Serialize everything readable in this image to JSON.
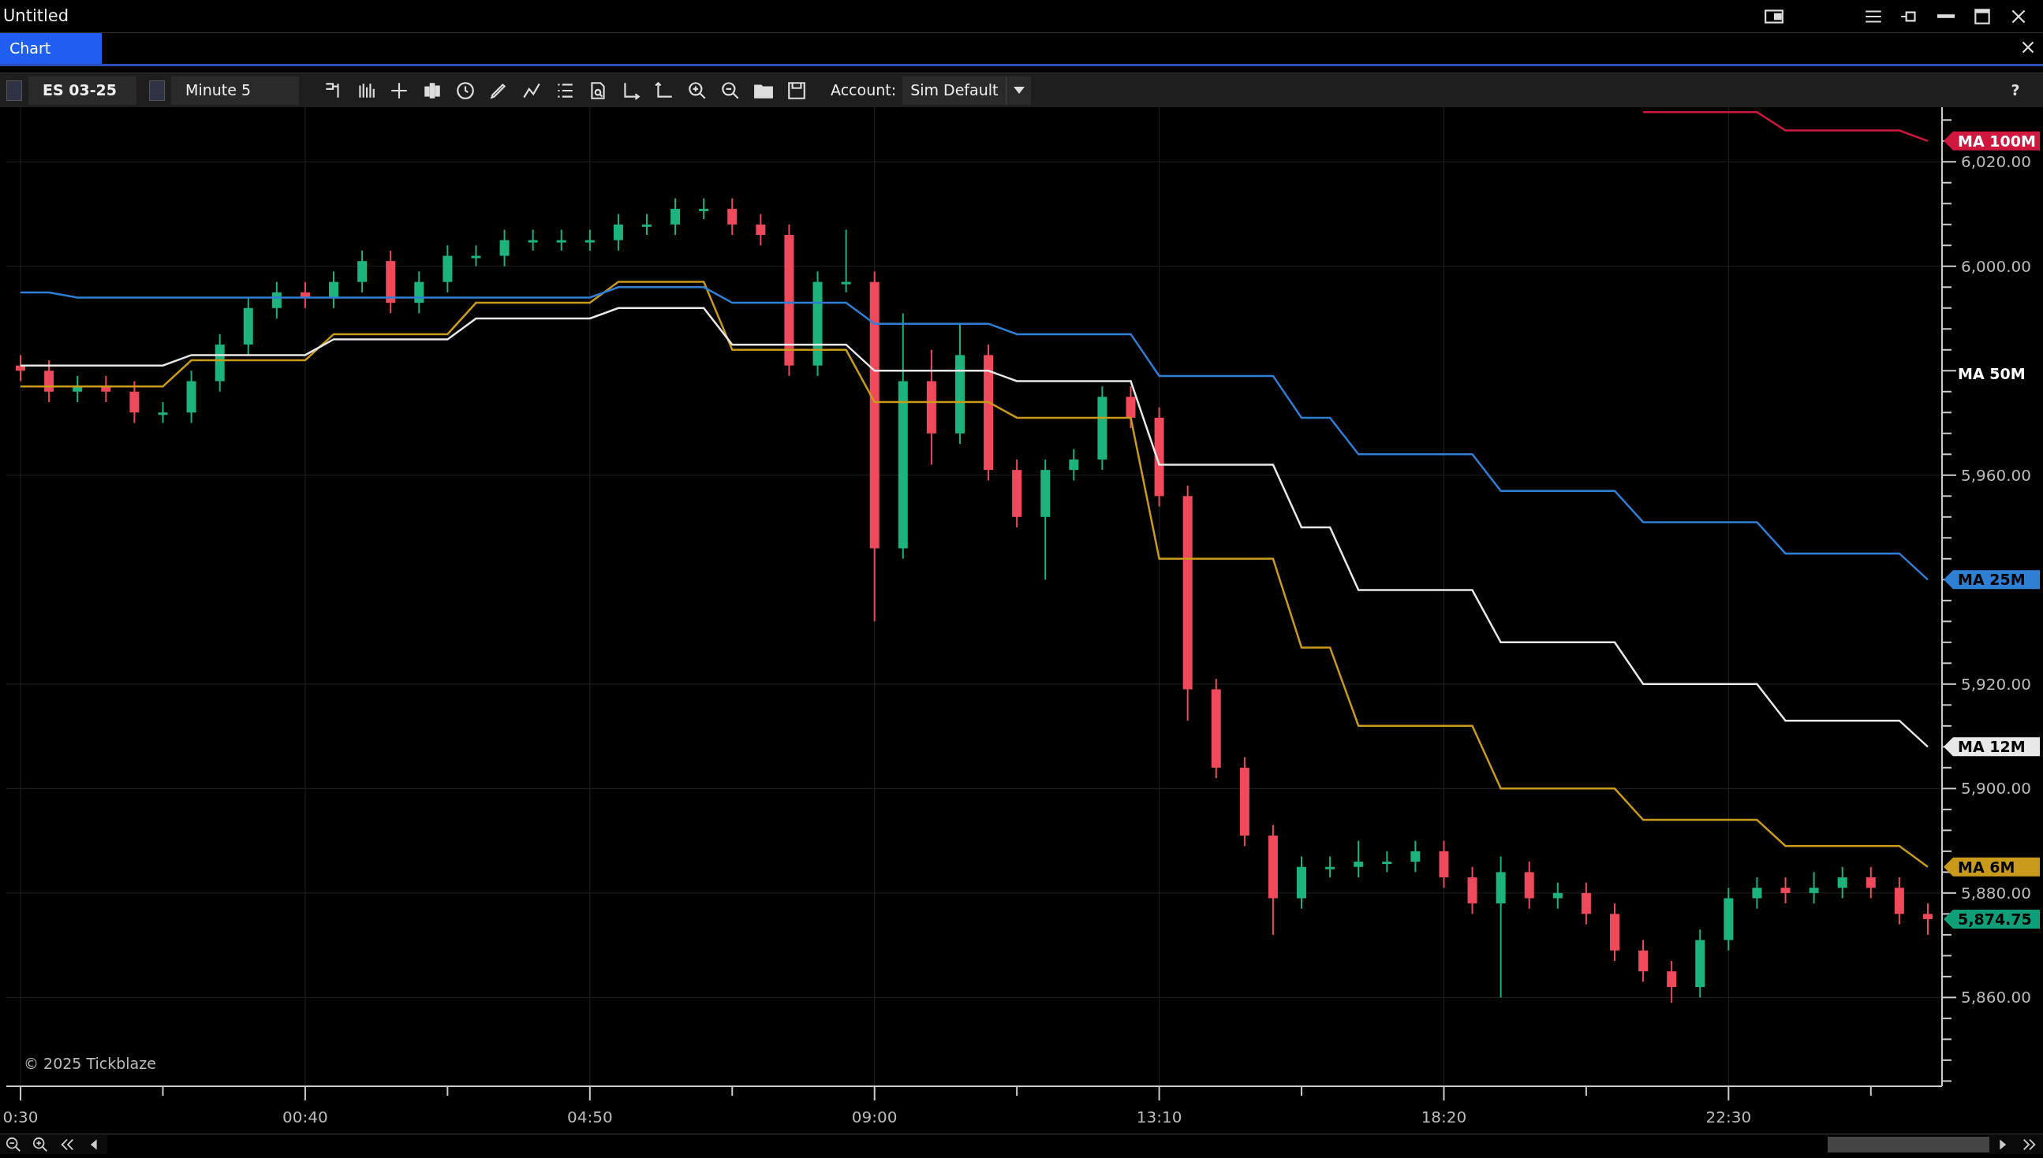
{
  "window": {
    "title": "Untitled"
  },
  "tabs": [
    {
      "label": "Chart",
      "selected": true
    }
  ],
  "toolbar": {
    "instrument": "ES 03-25",
    "interval": "Minute 5",
    "account_label": "Account:",
    "account": "Sim Default",
    "help": "?"
  },
  "chart": {
    "watermark": "© 2025 Tickblaze",
    "chart_data": {
      "type": "candlestick",
      "categories": [
        "0:30",
        null,
        null,
        null,
        null,
        null,
        null,
        null,
        null,
        null,
        "00:40",
        null,
        null,
        null,
        null,
        null,
        null,
        null,
        null,
        null,
        "04:50",
        null,
        null,
        null,
        null,
        null,
        null,
        null,
        null,
        null,
        "09:00",
        null,
        null,
        null,
        null,
        null,
        null,
        null,
        null,
        null,
        "13:10",
        null,
        null,
        null,
        null,
        null,
        null,
        null,
        null,
        null,
        "18:20",
        null,
        null,
        null,
        null,
        null,
        null,
        null,
        null,
        null,
        "22:30",
        null,
        null,
        null,
        null,
        null,
        null,
        null
      ],
      "ylim": [
        5843,
        6030
      ],
      "grid": true,
      "yticks": [
        {
          "value": 5860,
          "label": "5,860.00"
        },
        {
          "value": 5880,
          "label": "5,880.00"
        },
        {
          "value": 5900,
          "label": "5,900.00"
        },
        {
          "value": 5920,
          "label": "5,920.00"
        },
        {
          "value": 5960,
          "label": "5,960.00"
        },
        {
          "value": 6000,
          "label": "6,000.00"
        },
        {
          "value": 6020,
          "label": "6,020.00"
        }
      ],
      "ohlc": [
        [
          5981,
          5983,
          5978,
          5980
        ],
        [
          5980,
          5982,
          5974,
          5976
        ],
        [
          5976,
          5979,
          5974,
          5977
        ],
        [
          5977,
          5979,
          5974,
          5976
        ],
        [
          5976,
          5978,
          5970,
          5972
        ],
        [
          5972,
          5974,
          5970,
          5972
        ],
        [
          5972,
          5980,
          5970,
          5978
        ],
        [
          5978,
          5987,
          5976,
          5985
        ],
        [
          5985,
          5994,
          5983,
          5992
        ],
        [
          5992,
          5997,
          5990,
          5995
        ],
        [
          5995,
          5997,
          5992,
          5994
        ],
        [
          5994,
          5999,
          5992,
          5997
        ],
        [
          5997,
          6003,
          5995,
          6001
        ],
        [
          6001,
          6003,
          5991,
          5993
        ],
        [
          5993,
          5999,
          5991,
          5997
        ],
        [
          5997,
          6004,
          5995,
          6002
        ],
        [
          6002,
          6004,
          6000,
          6002
        ],
        [
          6002,
          6007,
          6000,
          6005
        ],
        [
          6005,
          6007,
          6003,
          6005
        ],
        [
          6005,
          6007,
          6003,
          6005
        ],
        [
          6005,
          6007,
          6003,
          6005
        ],
        [
          6005,
          6010,
          6003,
          6008
        ],
        [
          6008,
          6010,
          6006,
          6008
        ],
        [
          6008,
          6013,
          6006,
          6011
        ],
        [
          6011,
          6013,
          6009,
          6011
        ],
        [
          6011,
          6013,
          6006,
          6008
        ],
        [
          6008,
          6010,
          6004,
          6006
        ],
        [
          6006,
          6008,
          5979,
          5981
        ],
        [
          5981,
          5999,
          5979,
          5997
        ],
        [
          5997,
          6007,
          5995,
          5997
        ],
        [
          5997,
          5999,
          5932,
          5946
        ],
        [
          5946,
          5991,
          5944,
          5978
        ],
        [
          5978,
          5984,
          5962,
          5968
        ],
        [
          5968,
          5989,
          5966,
          5983
        ],
        [
          5983,
          5985,
          5959,
          5961
        ],
        [
          5961,
          5963,
          5950,
          5952
        ],
        [
          5952,
          5963,
          5940,
          5961
        ],
        [
          5961,
          5965,
          5959,
          5963
        ],
        [
          5963,
          5977,
          5961,
          5975
        ],
        [
          5975,
          5977,
          5969,
          5971
        ],
        [
          5971,
          5973,
          5954,
          5956
        ],
        [
          5956,
          5958,
          5913,
          5919
        ],
        [
          5919,
          5921,
          5902,
          5904
        ],
        [
          5904,
          5906,
          5889,
          5891
        ],
        [
          5891,
          5893,
          5872,
          5879
        ],
        [
          5879,
          5887,
          5877,
          5885
        ],
        [
          5885,
          5887,
          5883,
          5885
        ],
        [
          5885,
          5890,
          5883,
          5886
        ],
        [
          5886,
          5888,
          5884,
          5886
        ],
        [
          5886,
          5890,
          5884,
          5888
        ],
        [
          5888,
          5890,
          5881,
          5883
        ],
        [
          5883,
          5885,
          5876,
          5878
        ],
        [
          5878,
          5887,
          5860,
          5884
        ],
        [
          5884,
          5886,
          5877,
          5879
        ],
        [
          5879,
          5882,
          5877,
          5880
        ],
        [
          5880,
          5882,
          5874,
          5876
        ],
        [
          5876,
          5878,
          5867,
          5869
        ],
        [
          5869,
          5871,
          5863,
          5865
        ],
        [
          5865,
          5867,
          5859,
          5862
        ],
        [
          5862,
          5873,
          5860,
          5871
        ],
        [
          5871,
          5881,
          5869,
          5879
        ],
        [
          5879,
          5883,
          5877,
          5881
        ],
        [
          5881,
          5883,
          5878,
          5880
        ],
        [
          5880,
          5884,
          5878,
          5881
        ],
        [
          5881,
          5885,
          5879,
          5883
        ],
        [
          5883,
          5885,
          5879,
          5881
        ],
        [
          5881,
          5883,
          5874,
          5876
        ],
        [
          5876,
          5878,
          5872,
          5875
        ]
      ],
      "series": [
        {
          "name": "MA 6M",
          "type": "line",
          "color": "#c99a1c",
          "values": [
            5977,
            5977,
            5977,
            5977,
            5977,
            5977,
            5982,
            5982,
            5982,
            5982,
            5982,
            5987,
            5987,
            5987,
            5987,
            5987,
            5993,
            5993,
            5993,
            5993,
            5993,
            5997,
            5997,
            5997,
            5997,
            5984,
            5984,
            5984,
            5984,
            5984,
            5974,
            5974,
            5974,
            5974,
            5974,
            5971,
            5971,
            5971,
            5971,
            5971,
            5944,
            5944,
            5944,
            5944,
            5944,
            5927,
            5927,
            5912,
            5912,
            5912,
            5912,
            5912,
            5900,
            5900,
            5900,
            5900,
            5900,
            5894,
            5894,
            5894,
            5894,
            5894,
            5889,
            5889,
            5889,
            5889,
            5889,
            5885
          ]
        },
        {
          "name": "MA 12M",
          "type": "line",
          "color": "#e8e8e8",
          "values": [
            5981,
            5981,
            5981,
            5981,
            5981,
            5981,
            5983,
            5983,
            5983,
            5983,
            5983,
            5986,
            5986,
            5986,
            5986,
            5986,
            5990,
            5990,
            5990,
            5990,
            5990,
            5992,
            5992,
            5992,
            5992,
            5985,
            5985,
            5985,
            5985,
            5985,
            5980,
            5980,
            5980,
            5980,
            5980,
            5978,
            5978,
            5978,
            5978,
            5978,
            5962,
            5962,
            5962,
            5962,
            5962,
            5950,
            5950,
            5938,
            5938,
            5938,
            5938,
            5938,
            5928,
            5928,
            5928,
            5928,
            5928,
            5920,
            5920,
            5920,
            5920,
            5920,
            5913,
            5913,
            5913,
            5913,
            5913,
            5908
          ]
        },
        {
          "name": "MA 25M",
          "type": "line",
          "color": "#2f7fd4",
          "values": [
            5995,
            5995,
            5994,
            5994,
            5994,
            5994,
            5994,
            5994,
            5994,
            5994,
            5994,
            5994,
            5994,
            5994,
            5994,
            5994,
            5994,
            5994,
            5994,
            5994,
            5994,
            5996,
            5996,
            5996,
            5996,
            5993,
            5993,
            5993,
            5993,
            5993,
            5989,
            5989,
            5989,
            5989,
            5989,
            5987,
            5987,
            5987,
            5987,
            5987,
            5979,
            5979,
            5979,
            5979,
            5979,
            5971,
            5971,
            5964,
            5964,
            5964,
            5964,
            5964,
            5957,
            5957,
            5957,
            5957,
            5957,
            5951,
            5951,
            5951,
            5951,
            5951,
            5945,
            5945,
            5945,
            5945,
            5945,
            5940
          ]
        },
        {
          "name": "MA 100M",
          "type": "line",
          "color": "#d0173e",
          "values": [
            null,
            null,
            null,
            null,
            null,
            null,
            null,
            null,
            null,
            null,
            null,
            null,
            null,
            null,
            null,
            null,
            null,
            null,
            null,
            null,
            null,
            null,
            null,
            null,
            null,
            null,
            null,
            null,
            null,
            null,
            null,
            null,
            null,
            null,
            null,
            null,
            null,
            null,
            null,
            null,
            null,
            null,
            null,
            null,
            null,
            null,
            null,
            null,
            null,
            null,
            null,
            null,
            null,
            null,
            null,
            null,
            null,
            6029.5,
            6029.5,
            6029.5,
            6029.5,
            6029.5,
            6026,
            6026,
            6026,
            6026,
            6026,
            6024
          ]
        }
      ],
      "annotations": [
        "MA 50M",
        "5,874.75"
      ]
    }
  }
}
